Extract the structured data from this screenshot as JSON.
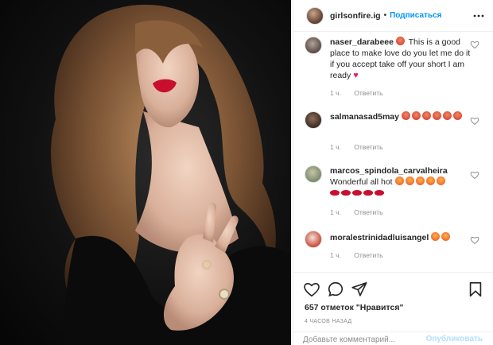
{
  "post": {
    "username": "girlsonfire.ig",
    "separator": "•",
    "follow_label": "Подписаться",
    "more_icon": "more-dots-icon"
  },
  "comments": [
    {
      "username": "naser_darabeee",
      "text": "This is a good place to make love do you let me do it if you accept take off your short I am ready",
      "trailing_emoji": "red-heart",
      "time": "1 ч.",
      "reply": "Ответить"
    },
    {
      "username": "salmanasad5may",
      "text": "",
      "emoji": [
        "tongue-face",
        "tongue-face",
        "tongue-face",
        "tongue-face",
        "tongue-face",
        "tongue-face"
      ],
      "time": "1 ч.",
      "reply": "Ответить"
    },
    {
      "username": "marcos_spindola_carvalheira",
      "text": "Wonderful all hot",
      "emoji": [
        "hot-face",
        "hot-face",
        "hot-face",
        "hot-face",
        "hot-face",
        "lips",
        "lips",
        "lips",
        "lips",
        "lips"
      ],
      "time": "1 ч.",
      "reply": "Ответить"
    },
    {
      "username": "moralestrinidadluisangel",
      "text": "",
      "emoji": [
        "hot-face",
        "hot-face"
      ],
      "time": "1 ч.",
      "reply": "Ответить"
    }
  ],
  "footer": {
    "likes": "657 отметок \"Нравится\"",
    "time_ago": "4 ЧАСОВ НАЗАД",
    "comment_placeholder": "Добавьте комментарий...",
    "publish_label": "Опубликовать"
  },
  "colors": {
    "accent": "#0095f6",
    "publish_disabled": "#b2dffc",
    "muted": "#8e8e8e",
    "text": "#262626"
  }
}
